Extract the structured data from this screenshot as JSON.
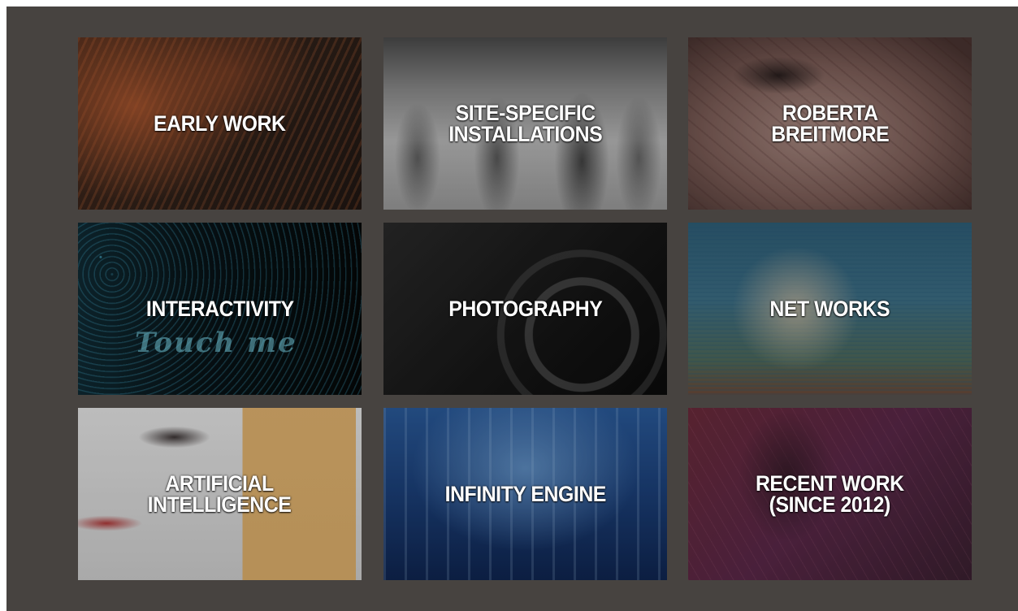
{
  "tiles": [
    {
      "label": "EARLY WORK",
      "bg": "early"
    },
    {
      "label": "SITE-SPECIFIC\nINSTALLATIONS",
      "bg": "site"
    },
    {
      "label": "ROBERTA\nBREITMORE",
      "bg": "roberta"
    },
    {
      "label": "INTERACTIVITY",
      "bg": "inter",
      "overlay_text": "Touch me"
    },
    {
      "label": "PHOTOGRAPHY",
      "bg": "photo"
    },
    {
      "label": "NET WORKS",
      "bg": "net"
    },
    {
      "label": "ARTIFICIAL\nINTELLIGENCE",
      "bg": "ai"
    },
    {
      "label": "INFINITY ENGINE",
      "bg": "infinity"
    },
    {
      "label": "RECENT WORK\n(SINCE 2012)",
      "bg": "recent"
    }
  ],
  "colors": {
    "frame_background": "#474340",
    "label_text": "#ffffff"
  }
}
